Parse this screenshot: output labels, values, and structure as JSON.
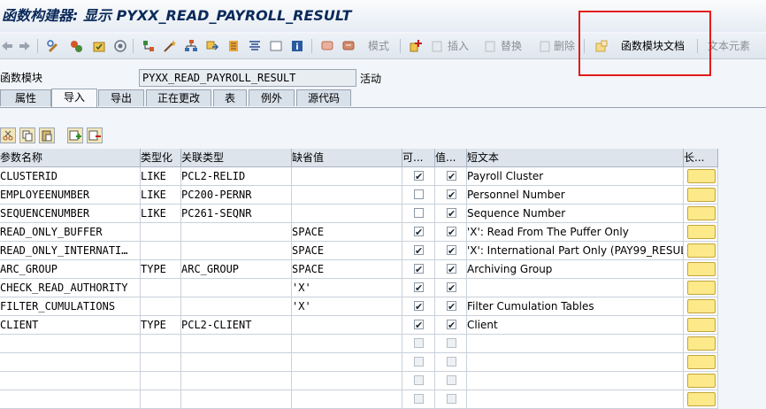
{
  "title": "函数构建器: 显示 PYXX_READ_PAYROLL_RESULT",
  "toolbar": {
    "pattern_label": "模式",
    "insert_label": "插入",
    "replace_label": "替换",
    "delete_label": "删除",
    "fm_doc_label": "函数模块文档",
    "text_elements_label": "文本元素"
  },
  "header": {
    "fm_label": "函数模块",
    "fm_value": "PYXX_READ_PAYROLL_RESULT",
    "status": "活动"
  },
  "tabs": [
    "属性",
    "导入",
    "导出",
    "正在更改",
    "表",
    "例外",
    "源代码"
  ],
  "active_tab": "导入",
  "columns": [
    "参数名称",
    "类型化",
    "关联类型",
    "缺省值",
    "可...",
    "值...",
    "短文本",
    "长..."
  ],
  "rows": [
    {
      "name": "CLUSTERID",
      "typing": "LIKE",
      "ref": "PCL2-RELID",
      "default": "",
      "optional": true,
      "value": true,
      "text": "Payroll Cluster"
    },
    {
      "name": "EMPLOYEENUMBER",
      "typing": "LIKE",
      "ref": "PC200-PERNR",
      "default": "",
      "optional": false,
      "value": true,
      "text": "Personnel Number"
    },
    {
      "name": "SEQUENCENUMBER",
      "typing": "LIKE",
      "ref": "PC261-SEQNR",
      "default": "",
      "optional": false,
      "value": true,
      "text": "Sequence Number"
    },
    {
      "name": "READ_ONLY_BUFFER",
      "typing": "",
      "ref": "",
      "default": "SPACE",
      "optional": true,
      "value": true,
      "text": "'X': Read From The Puffer Only"
    },
    {
      "name": "READ_ONLY_INTERNATI…",
      "typing": "",
      "ref": "",
      "default": "SPACE",
      "optional": true,
      "value": true,
      "text": "'X': International Part Only (PAY99_RESUL…"
    },
    {
      "name": "ARC_GROUP",
      "typing": "TYPE",
      "ref": "ARC_GROUP",
      "default": "SPACE",
      "optional": true,
      "value": true,
      "text": "Archiving Group"
    },
    {
      "name": "CHECK_READ_AUTHORITY",
      "typing": "",
      "ref": "",
      "default": "'X'",
      "optional": true,
      "value": true,
      "text": ""
    },
    {
      "name": "FILTER_CUMULATIONS",
      "typing": "",
      "ref": "",
      "default": "'X'",
      "optional": true,
      "value": true,
      "text": "Filter Cumulation Tables"
    },
    {
      "name": "CLIENT",
      "typing": "TYPE",
      "ref": "PCL2-CLIENT",
      "default": "",
      "optional": true,
      "value": true,
      "text": "Client"
    }
  ],
  "empty_rows": 4,
  "colors": {
    "highlight_box": "#e21b1b",
    "title_text": "#0a2a5a",
    "long_text_button": "#fce98a"
  }
}
